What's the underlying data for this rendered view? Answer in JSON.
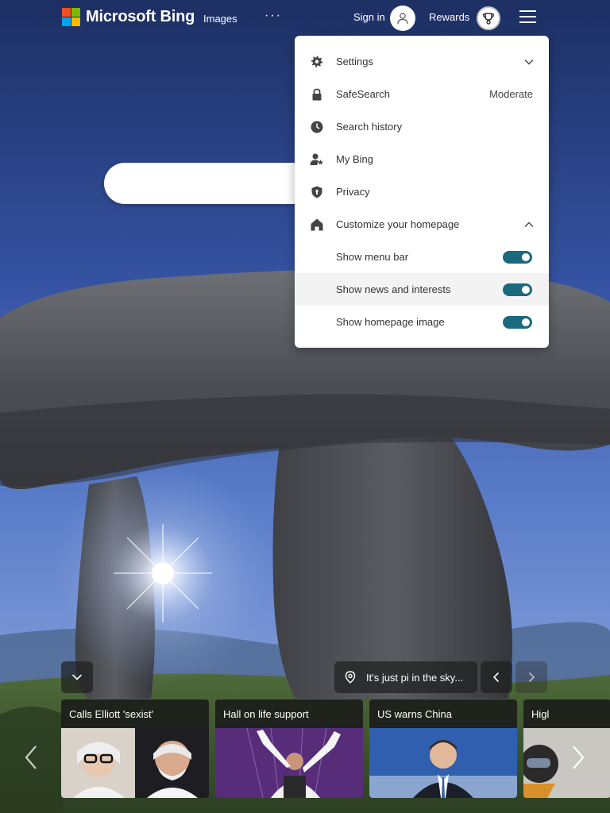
{
  "header": {
    "logo_text": "Microsoft Bing",
    "nav_images": "Images",
    "nav_more": "···",
    "sign_in": "Sign in",
    "rewards": "Rewards"
  },
  "settings_menu": {
    "settings": "Settings",
    "safesearch": "SafeSearch",
    "safesearch_value": "Moderate",
    "search_history": "Search history",
    "my_bing": "My Bing",
    "privacy": "Privacy",
    "customize": "Customize your homepage",
    "show_menu_bar": "Show menu bar",
    "show_menu_bar_on": true,
    "show_news": "Show news and interests",
    "show_news_on": true,
    "show_image": "Show homepage image",
    "show_image_on": true
  },
  "image_caption": "It's just pi in the sky...",
  "news": [
    {
      "headline": "Calls Elliott 'sexist'"
    },
    {
      "headline": "Hall on life support"
    },
    {
      "headline": "US warns China"
    },
    {
      "headline": "Higl"
    }
  ],
  "colors": {
    "toggle_on": "#1a6a7f",
    "ms_red": "#f25022",
    "ms_green": "#7fba00",
    "ms_blue": "#00a4ef",
    "ms_yellow": "#ffb900"
  }
}
